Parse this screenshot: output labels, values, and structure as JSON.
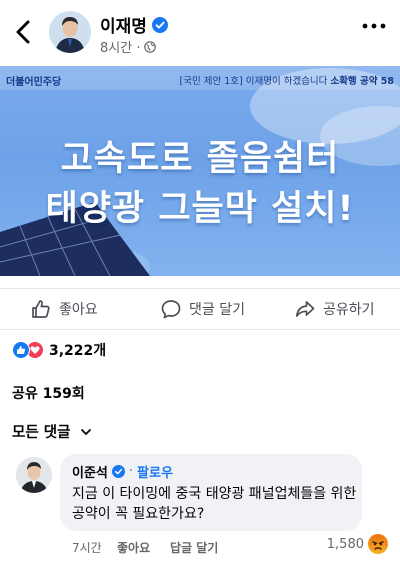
{
  "post": {
    "author": "이재명",
    "time": "8시간 ·",
    "privacy_icon": "globe-icon",
    "more_icon": "ellipsis-icon"
  },
  "banner": {
    "party": "더불어민주당",
    "pledge_prefix": "[국민 제안 1호] 이재명이 하겠습니다",
    "pledge_suffix": "소확행 공약 58",
    "headline_line1": "고속도로 졸음쉼터",
    "headline_line2": "태양광 그늘막 설치!"
  },
  "actions": {
    "like": "좋아요",
    "comment": "댓글 달기",
    "share": "공유하기"
  },
  "stats": {
    "reaction_count": "3,222개",
    "shares": "공유 159회",
    "sort_label": "모든 댓글"
  },
  "comment": {
    "author": "이준석",
    "separator": "·",
    "follow": "팔로우",
    "text": "지금 이 타이밍에 중국 태양광 패널업체들을 위한 공약이 꼭 필요한가요?",
    "time": "7시간",
    "like": "좋아요",
    "reply": "답글 달기",
    "reaction_count": "1,580"
  },
  "colors": {
    "accent": "#1877f2",
    "love": "#f33e58",
    "banner_blue": "#79a9ec"
  }
}
